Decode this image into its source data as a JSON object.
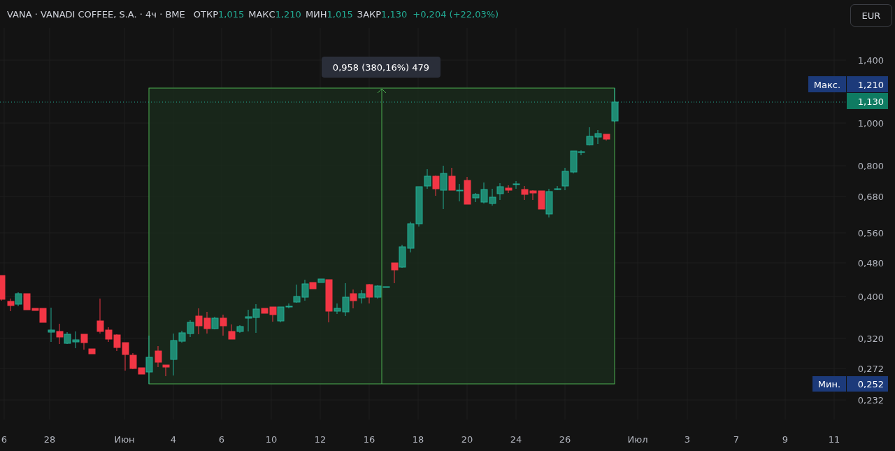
{
  "header": {
    "symbol_line": "VANA · VANADI COFFEE, S.A. · 4ч · BME",
    "ohlc": [
      {
        "label": "ОТКР",
        "value": "1,015"
      },
      {
        "label": "МАКС",
        "value": "1,210"
      },
      {
        "label": "МИН",
        "value": "1,015"
      },
      {
        "label": "ЗАКР",
        "value": "1,130"
      }
    ],
    "change": "+0,204 (+22,03%)"
  },
  "currency_button": "EUR",
  "measure_tooltip": "0,958 (380,16%) 479",
  "price_axis": {
    "ticks": [
      "1,400",
      "1,000",
      "0,800",
      "0,680",
      "0,560",
      "0,480",
      "0,400",
      "0,320",
      "0,272",
      "0,232"
    ]
  },
  "high_marker": {
    "label": "Макс.",
    "value": "1,210"
  },
  "last_price": "1,130",
  "low_marker": {
    "label": "Мин.",
    "value": "0,252"
  },
  "time_axis": {
    "labels": [
      "6",
      "28",
      "Июн",
      "4",
      "6",
      "10",
      "12",
      "16",
      "18",
      "20",
      "24",
      "26",
      "Июл",
      "3",
      "7",
      "9",
      "11"
    ]
  }
}
